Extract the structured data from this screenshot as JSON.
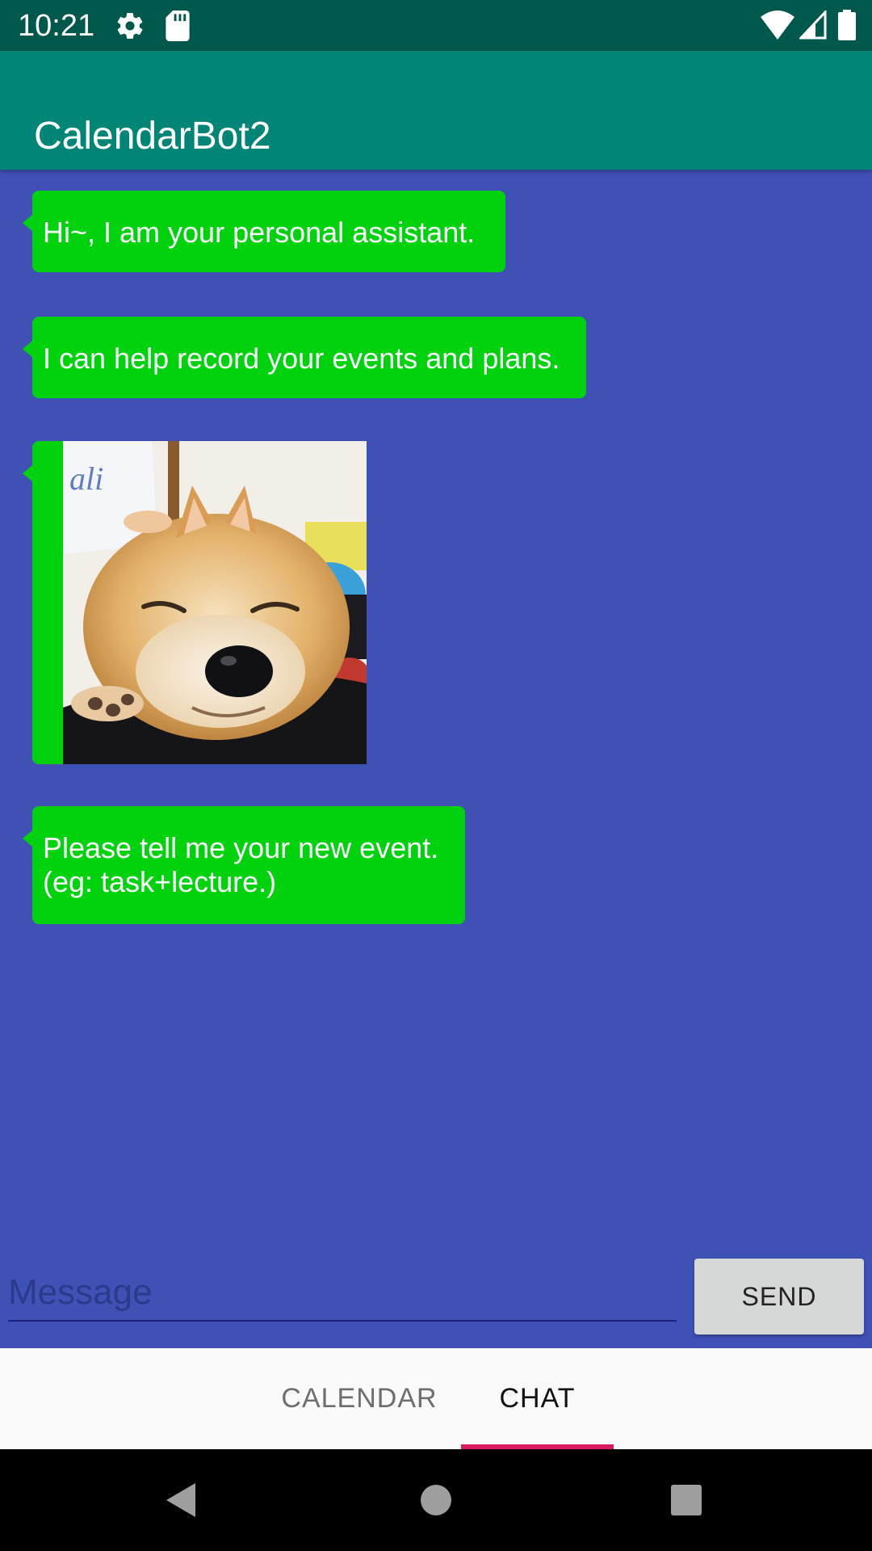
{
  "status_bar": {
    "time": "10:21",
    "icons": [
      "gear-icon",
      "sd-card-icon",
      "wifi-icon",
      "signal-icon",
      "battery-icon"
    ]
  },
  "app_bar": {
    "title": "CalendarBot2"
  },
  "messages": [
    {
      "type": "text",
      "text": "Hi~, I am your personal assistant."
    },
    {
      "type": "text",
      "text": "I can help record your events and plans."
    },
    {
      "type": "image",
      "subject": "shiba-inu-dog-photo"
    },
    {
      "type": "text",
      "text": "Please tell me your new event.\n(eg: task+lecture.)"
    }
  ],
  "composer": {
    "placeholder": "Message",
    "value": "",
    "send_label": "SEND"
  },
  "tabs": [
    {
      "label": "CALENDAR",
      "selected": false
    },
    {
      "label": "CHAT",
      "selected": true
    }
  ],
  "colors": {
    "status_bar": "#00574b",
    "app_bar": "#008577",
    "chat_background": "#3f51b5",
    "bubble": "#00d30e",
    "tab_indicator": "#d81b60"
  },
  "nav_bar": {
    "icons": [
      "back-icon",
      "home-icon",
      "recents-icon"
    ]
  }
}
